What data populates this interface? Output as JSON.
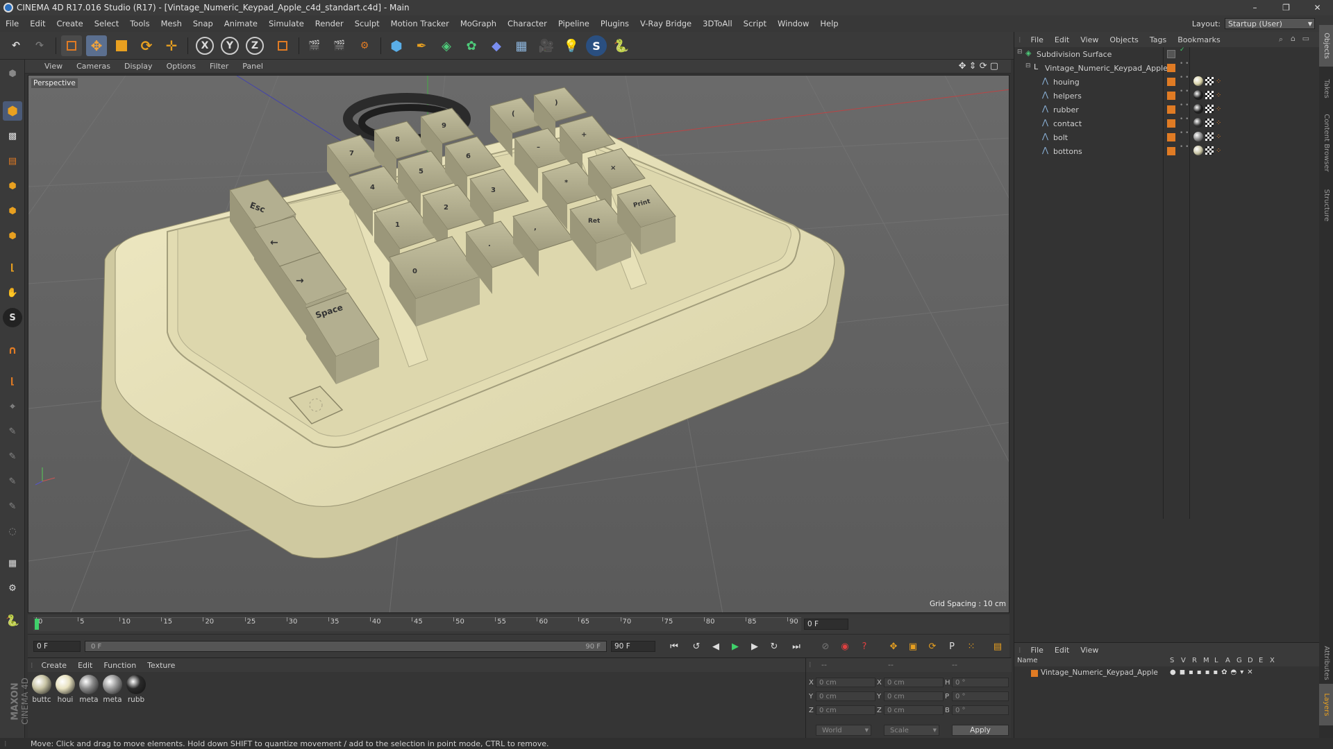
{
  "titlebar": {
    "title": "CINEMA 4D R17.016 Studio (R17) - [Vintage_Numeric_Keypad_Apple_c4d_standart.c4d] - Main",
    "minimize": "–",
    "restore": "❐",
    "close": "✕"
  },
  "menu": [
    "File",
    "Edit",
    "Create",
    "Select",
    "Tools",
    "Mesh",
    "Snap",
    "Animate",
    "Simulate",
    "Render",
    "Sculpt",
    "Motion Tracker",
    "MoGraph",
    "Character",
    "Pipeline",
    "Plugins",
    "V-Ray Bridge",
    "3DToAll",
    "Script",
    "Window",
    "Help"
  ],
  "layout": {
    "label": "Layout:",
    "value": "Startup (User)"
  },
  "toolbar": {
    "x_label": "X",
    "y_label": "Y",
    "z_label": "Z"
  },
  "viewport": {
    "menu": [
      "View",
      "Cameras",
      "Display",
      "Options",
      "Filter",
      "Panel"
    ],
    "camera_label": "Perspective",
    "grid_spacing": "Grid Spacing : 10 cm",
    "keys": {
      "esc": "Esc",
      "left": "←",
      "right": "→",
      "space": "Space",
      "k7": "7",
      "k8": "8",
      "k9": "9",
      "k4": "4",
      "k5": "5",
      "k6": "6",
      "k1": "1",
      "k2": "2",
      "k3": "3",
      "k0": "0",
      "dot": ".",
      "comma": ",",
      "paren_open": "(",
      "paren_close": ")",
      "minus": "–",
      "plus": "+",
      "star": "*",
      "times": "×",
      "ret": "Ret",
      "print": "Print"
    }
  },
  "timeline": {
    "ticks": [
      "0",
      "5",
      "10",
      "15",
      "20",
      "25",
      "30",
      "35",
      "40",
      "45",
      "50",
      "55",
      "60",
      "65",
      "70",
      "75",
      "80",
      "85",
      "90"
    ],
    "current_frame": "0 F"
  },
  "playback": {
    "start_field": "0 F",
    "range_start": "0 F",
    "range_end": "90 F",
    "end_field": "90 F"
  },
  "materials": {
    "menu": [
      "Create",
      "Edit",
      "Function",
      "Texture"
    ],
    "items": [
      {
        "label": "buttc",
        "color": "#c8c4a4"
      },
      {
        "label": "houi",
        "color": "#e8e2c0"
      },
      {
        "label": "meta",
        "color": "#8a8a8a"
      },
      {
        "label": "meta",
        "color": "#9a9a9a"
      },
      {
        "label": "rubb",
        "color": "#2a2a2a"
      }
    ]
  },
  "coords": {
    "header_a": "--",
    "header_b": "--",
    "header_c": "--",
    "rows": [
      {
        "axis": "X",
        "pos": "0 cm",
        "axis2": "X",
        "size": "0 cm",
        "rot_axis": "H",
        "rot": "0 °"
      },
      {
        "axis": "Y",
        "pos": "0 cm",
        "axis2": "Y",
        "size": "0 cm",
        "rot_axis": "P",
        "rot": "0 °"
      },
      {
        "axis": "Z",
        "pos": "0 cm",
        "axis2": "Z",
        "size": "0 cm",
        "rot_axis": "B",
        "rot": "0 °"
      }
    ],
    "space": "World",
    "mode": "Scale",
    "apply": "Apply"
  },
  "objects": {
    "menu": [
      "File",
      "Edit",
      "View",
      "Objects",
      "Tags",
      "Bookmarks"
    ],
    "tree": [
      {
        "name": "Subdivision Surface",
        "level": 0
      },
      {
        "name": "Vintage_Numeric_Keypad_Apple",
        "level": 1
      },
      {
        "name": "houing",
        "level": 2
      },
      {
        "name": "helpers",
        "level": 2
      },
      {
        "name": "rubber",
        "level": 2
      },
      {
        "name": "contact",
        "level": 2
      },
      {
        "name": "bolt",
        "level": 2
      },
      {
        "name": "bottons",
        "level": 2
      }
    ]
  },
  "layers": {
    "menu": [
      "File",
      "Edit",
      "View"
    ],
    "header": {
      "name": "Name",
      "cols": [
        "S",
        "V",
        "R",
        "M",
        "L",
        "A",
        "G",
        "D",
        "E",
        "X"
      ]
    },
    "row": "Vintage_Numeric_Keypad_Apple"
  },
  "side_tabs": [
    "Objects",
    "Takes",
    "Content Browser",
    "Structure",
    "Attributes",
    "Layers"
  ],
  "brand": {
    "a": "MAXON",
    "b": "CINEMA 4D"
  },
  "status": "Move: Click and drag to move elements. Hold down SHIFT to quantize movement / add to the selection in point mode, CTRL to remove.",
  "colors": {
    "accent_orange": "#e07b24",
    "selection_blue": "#4a7ab8",
    "keypad_body": "#e5dfb4",
    "key_cap": "#b9b596"
  }
}
